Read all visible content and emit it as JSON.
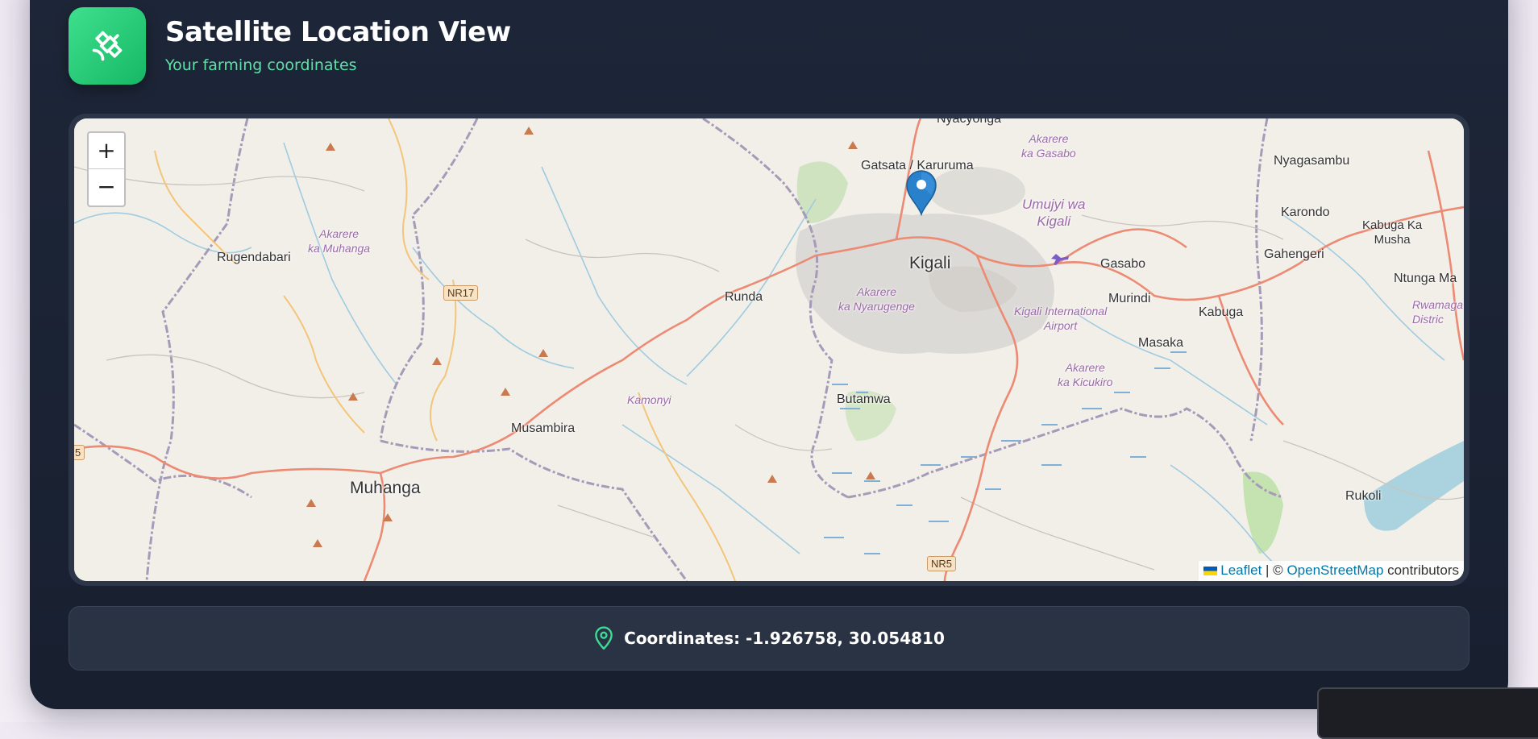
{
  "header": {
    "title": "Satellite Location View",
    "subtitle": "Your farming coordinates",
    "logo_icon": "satellite-icon"
  },
  "map": {
    "zoom_in_label": "+",
    "zoom_out_label": "−",
    "places": {
      "nyacyonga": "Nyacyonga",
      "akarere_gasabo": "Akarere\nka Gasabo",
      "nyagasambu": "Nyagasambu",
      "gatsata": "Gatsata / Karuruma",
      "karondo": "Karondo",
      "umujyi": "Umujyi wa\nKigali",
      "kabuga_ka_musha": "Kabuga Ka\nMusha",
      "rugendabari": "Rugendabari",
      "akarere_muhanga": "Akarere\nka Muhanga",
      "kigali": "Kigali",
      "gahengeri": "Gahengeri",
      "gasabo": "Gasabo",
      "ntunga": "Ntunga Ma",
      "runda": "Runda",
      "akarere_nyarugenge": "Akarere\nka Nyarugenge",
      "murindi": "Murindi",
      "rwamagana": "Rwamaga\nDistric",
      "kigali_airport": "Kigali International\nAirport",
      "kabuga": "Kabuga",
      "masaka": "Masaka",
      "akarere_kicukiro": "Akarere\nka Kicukiro",
      "butamwa": "Butamwa",
      "kamonyi": "Kamonyi",
      "musambira": "Musambira",
      "muhanga": "Muhanga",
      "rukoli": "Rukoli"
    },
    "road_shields": {
      "nr17": "NR17",
      "nr5": "NR5",
      "edge5": "5"
    },
    "attribution": {
      "leaflet": "Leaflet",
      "separator": " | © ",
      "osm": "OpenStreetMap",
      "suffix": " contributors"
    }
  },
  "coordinates": {
    "text": "Coordinates: -1.926758, 30.054810",
    "icon": "map-pin-icon"
  },
  "colors": {
    "accent_green": "#22c55e",
    "card_bg": "#1d2638",
    "subtitle": "#5fe0a6",
    "marker_blue": "#2a81cb"
  }
}
